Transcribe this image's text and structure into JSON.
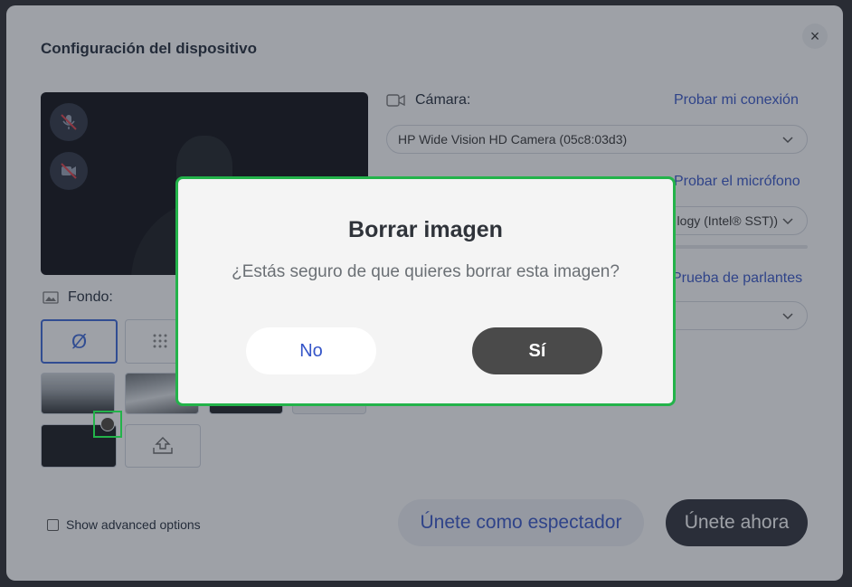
{
  "modal": {
    "title": "Configuración del dispositivo",
    "close_label": "×"
  },
  "camera": {
    "label": "Cámara:",
    "test_link": "Probar mi conexión",
    "selected": "HP Wide Vision HD Camera (05c8:03d3)"
  },
  "microphone": {
    "test_link": "Probar el micrófono",
    "selected_partial": "logy (Intel® SST))"
  },
  "speakers": {
    "test_link": "Prueba de parlantes"
  },
  "background": {
    "label": "Fondo:",
    "none_symbol": "Ø"
  },
  "advanced": {
    "label": "Show advanced options"
  },
  "actions": {
    "spectator": "Únete como espectador",
    "join": "Únete ahora"
  },
  "dialog": {
    "title": "Borrar imagen",
    "message": "¿Estás seguro de que quieres borrar esta imagen?",
    "no": "No",
    "yes": "Sí"
  },
  "colors": {
    "accent": "#3555c8",
    "highlight": "#23b34a",
    "dark_button": "#2c2f38"
  }
}
